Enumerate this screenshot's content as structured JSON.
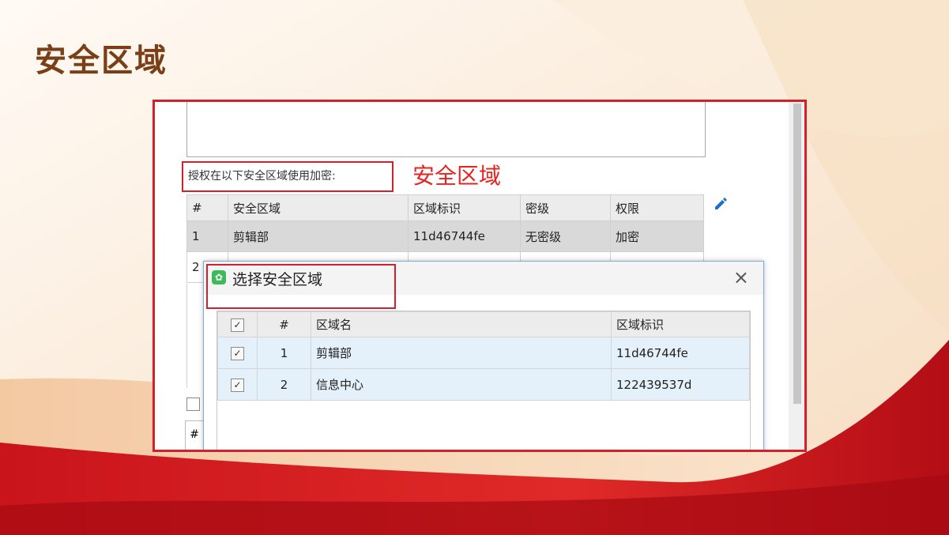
{
  "slide": {
    "title": "安全区域"
  },
  "form": {
    "auth_label": "授权在以下安全区域使用加密:",
    "annotation": "安全区域",
    "table": {
      "headers": [
        "#",
        "安全区域",
        "区域标识",
        "密级",
        "权限"
      ],
      "rows": [
        [
          "1",
          "剪辑部",
          "11d46744fe",
          "无密级",
          "加密"
        ],
        [
          "2",
          "",
          "",
          "",
          ""
        ]
      ]
    },
    "bottom_header": "#"
  },
  "dialog": {
    "title": "选择安全区域",
    "close_glyph": "×",
    "table": {
      "headers": [
        "",
        "#",
        "区域名",
        "区域标识"
      ],
      "rows": [
        {
          "checked": "✓",
          "index": "1",
          "name": "剪辑部",
          "id": "11d46744fe"
        },
        {
          "checked": "✓",
          "index": "2",
          "name": "信息中心",
          "id": "122439537d"
        }
      ],
      "header_check": "✓"
    }
  },
  "colors": {
    "highlight": "#d4202b",
    "title_brown": "#7a3f16",
    "annotation_red": "#e8231f"
  },
  "icons": {
    "edit": "pencil-icon",
    "close": "close-icon",
    "app": "app-icon"
  }
}
